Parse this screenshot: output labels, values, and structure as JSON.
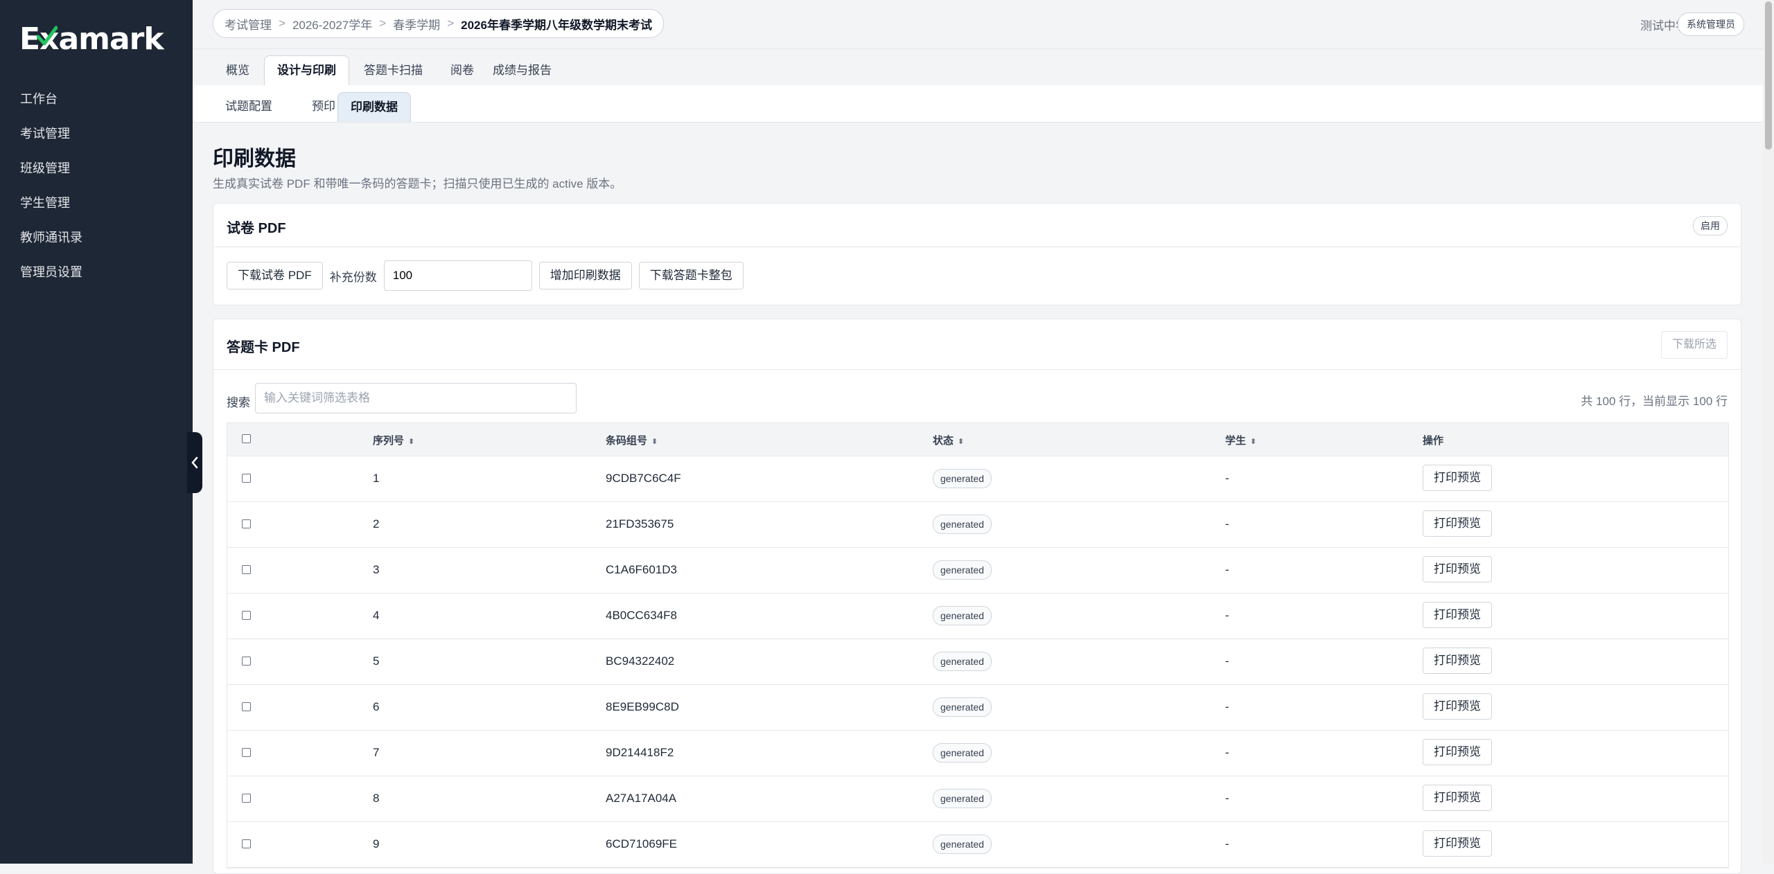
{
  "sidebar": {
    "logo_text": "Examark",
    "items": [
      {
        "label": "工作台"
      },
      {
        "label": "考试管理"
      },
      {
        "label": "班级管理"
      },
      {
        "label": "学生管理"
      },
      {
        "label": "教师通讯录"
      },
      {
        "label": "管理员设置"
      }
    ]
  },
  "breadcrumb": [
    "考试管理",
    "2026-2027学年",
    "春季学期",
    "2026年春季学期八年级数学期末考试"
  ],
  "breadcrumb_separator": ">",
  "header": {
    "school": "测试中学",
    "role": "系统管理员"
  },
  "tabs": [
    "概览",
    "设计与印刷",
    "答题卡扫描",
    "阅卷",
    "成绩与报告"
  ],
  "active_tab": "设计与印刷",
  "subtabs": [
    "试题配置",
    "预印",
    "印刷数据"
  ],
  "active_subtab": "印刷数据",
  "page": {
    "title": "印刷数据",
    "description": "生成真实试卷 PDF 和带唯一条码的答题卡；扫描只使用已生成的 active 版本。"
  },
  "exam_pdf": {
    "title": "试卷 PDF",
    "status": "启用",
    "download_label": "下载试卷 PDF",
    "extra_copies_label": "补充份数",
    "extra_copies_value": "100",
    "add_print_label": "增加印刷数据",
    "download_bundle_label": "下载答题卡整包"
  },
  "answer_pdf": {
    "title": "答题卡 PDF",
    "download_selected_label": "下载所选",
    "search_label": "搜索",
    "search_placeholder": "输入关键词筛选表格",
    "count_text": "共 100 行，当前显示 100 行",
    "columns": [
      "序列号",
      "条码组号",
      "状态",
      "学生",
      "操作"
    ],
    "rows": [
      {
        "seq": "1",
        "code": "9CDB7C6C4F",
        "status": "generated",
        "student": "-",
        "action": "打印预览"
      },
      {
        "seq": "2",
        "code": "21FD353675",
        "status": "generated",
        "student": "-",
        "action": "打印预览"
      },
      {
        "seq": "3",
        "code": "C1A6F601D3",
        "status": "generated",
        "student": "-",
        "action": "打印预览"
      },
      {
        "seq": "4",
        "code": "4B0CC634F8",
        "status": "generated",
        "student": "-",
        "action": "打印预览"
      },
      {
        "seq": "5",
        "code": "BC94322402",
        "status": "generated",
        "student": "-",
        "action": "打印预览"
      },
      {
        "seq": "6",
        "code": "8E9EB99C8D",
        "status": "generated",
        "student": "-",
        "action": "打印预览"
      },
      {
        "seq": "7",
        "code": "9D214418F2",
        "status": "generated",
        "student": "-",
        "action": "打印预览"
      },
      {
        "seq": "8",
        "code": "A27A17A04A",
        "status": "generated",
        "student": "-",
        "action": "打印预览"
      },
      {
        "seq": "9",
        "code": "6CD71069FE",
        "status": "generated",
        "student": "-",
        "action": "打印预览"
      }
    ]
  },
  "icons": {
    "collapse": "chevron-left-icon",
    "sort": "sort-icon",
    "logo_check": "checkmark-icon"
  },
  "colors": {
    "sidebar_bg": "#1e2735",
    "logo_check": "#22c55e"
  }
}
